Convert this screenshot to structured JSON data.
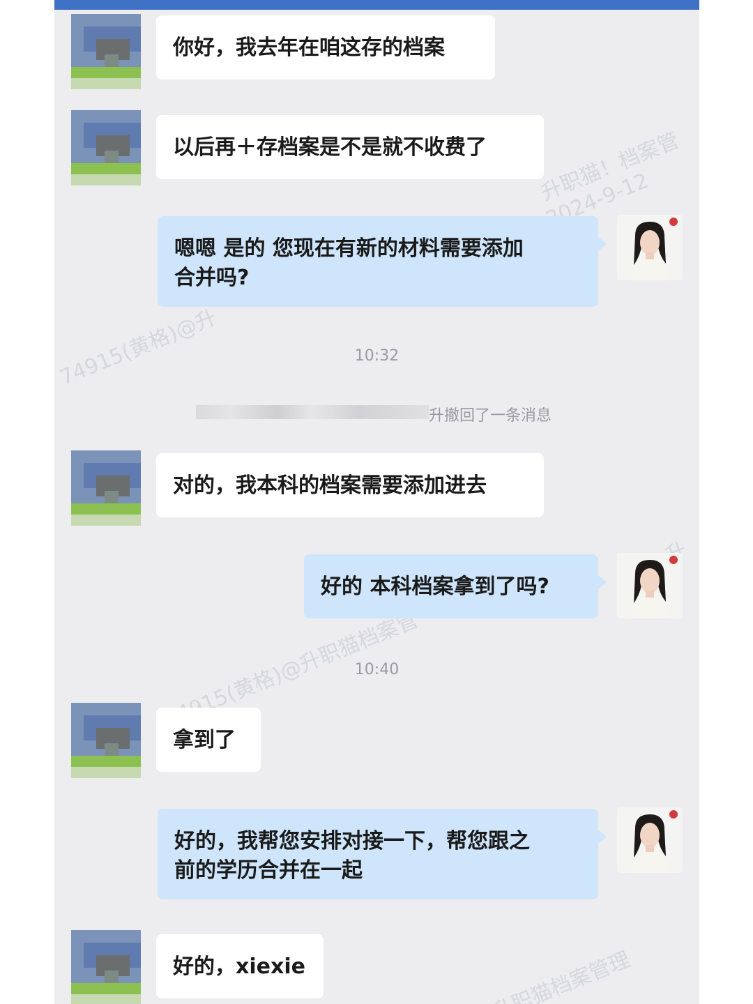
{
  "watermarks": [
    "升职猫！档案管",
    "2024-9-12",
    "74915(黄格)@升",
    "74915(黄格)@升职猫档案管",
    "升职猫档案管理",
    "升"
  ],
  "messages": [
    {
      "side": "in",
      "text": "你好，我去年在咱这存的档案"
    },
    {
      "side": "in",
      "text": "以后再＋存档案是不是就不收费了"
    },
    {
      "side": "out",
      "lines": [
        "嗯嗯 是的 您现在有新的材料需要添加",
        "合并吗?"
      ]
    },
    {
      "side": "in",
      "text": "对的，我本科的档案需要添加进去"
    },
    {
      "side": "out",
      "text": "好的 本科档案拿到了吗?"
    },
    {
      "side": "in",
      "text": "拿到了"
    },
    {
      "side": "out",
      "lines": [
        "好的，我帮您安排对接一下，帮您跟之",
        "前的学历合并在一起"
      ]
    },
    {
      "side": "in",
      "text": "好的，xiexie"
    }
  ],
  "timestamps": [
    "10:32",
    "10:40"
  ],
  "recall_notice": "升撤回了一条消息",
  "colors": {
    "outgoing_bubble": "#cfe5fb",
    "incoming_bubble": "#ffffff",
    "background": "#ededef",
    "topbar": "#3f72c5"
  }
}
